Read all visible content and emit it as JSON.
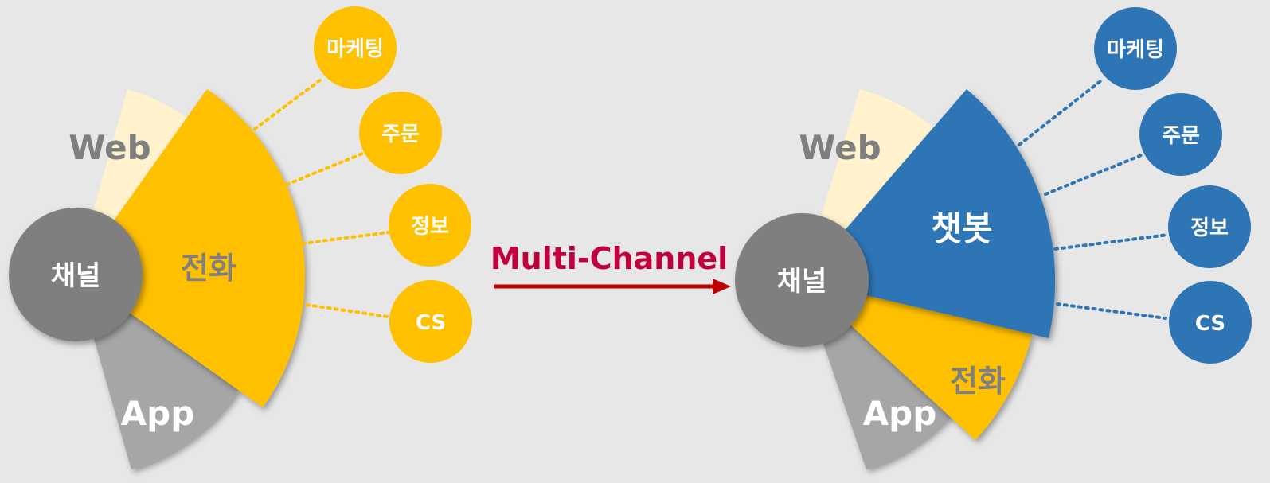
{
  "colors": {
    "background": "#e7e7e7",
    "yellow": "#ffc000",
    "web_sector": "#fff2cc",
    "app_sector": "#a6a6a6",
    "hub": "#7f7f7f",
    "blue": "#2e75b6",
    "sector_text_gray": "#7f7f7f",
    "arrow_red": "#c00000",
    "title_red": "#c0003c",
    "white": "#ffffff"
  },
  "left_diagram": {
    "hub_label": "채널",
    "web_label": "Web",
    "app_label": "App",
    "main_sector_label": "전화",
    "bubbles": [
      "마케팅",
      "주문",
      "정보",
      "CS"
    ]
  },
  "transition": {
    "label": "Multi-Channel"
  },
  "right_diagram": {
    "hub_label": "채널",
    "web_label": "Web",
    "app_label": "App",
    "phone_sector_label": "전화",
    "chatbot_sector_label": "챗봇",
    "bubbles": [
      "마케팅",
      "주문",
      "정보",
      "CS"
    ]
  }
}
